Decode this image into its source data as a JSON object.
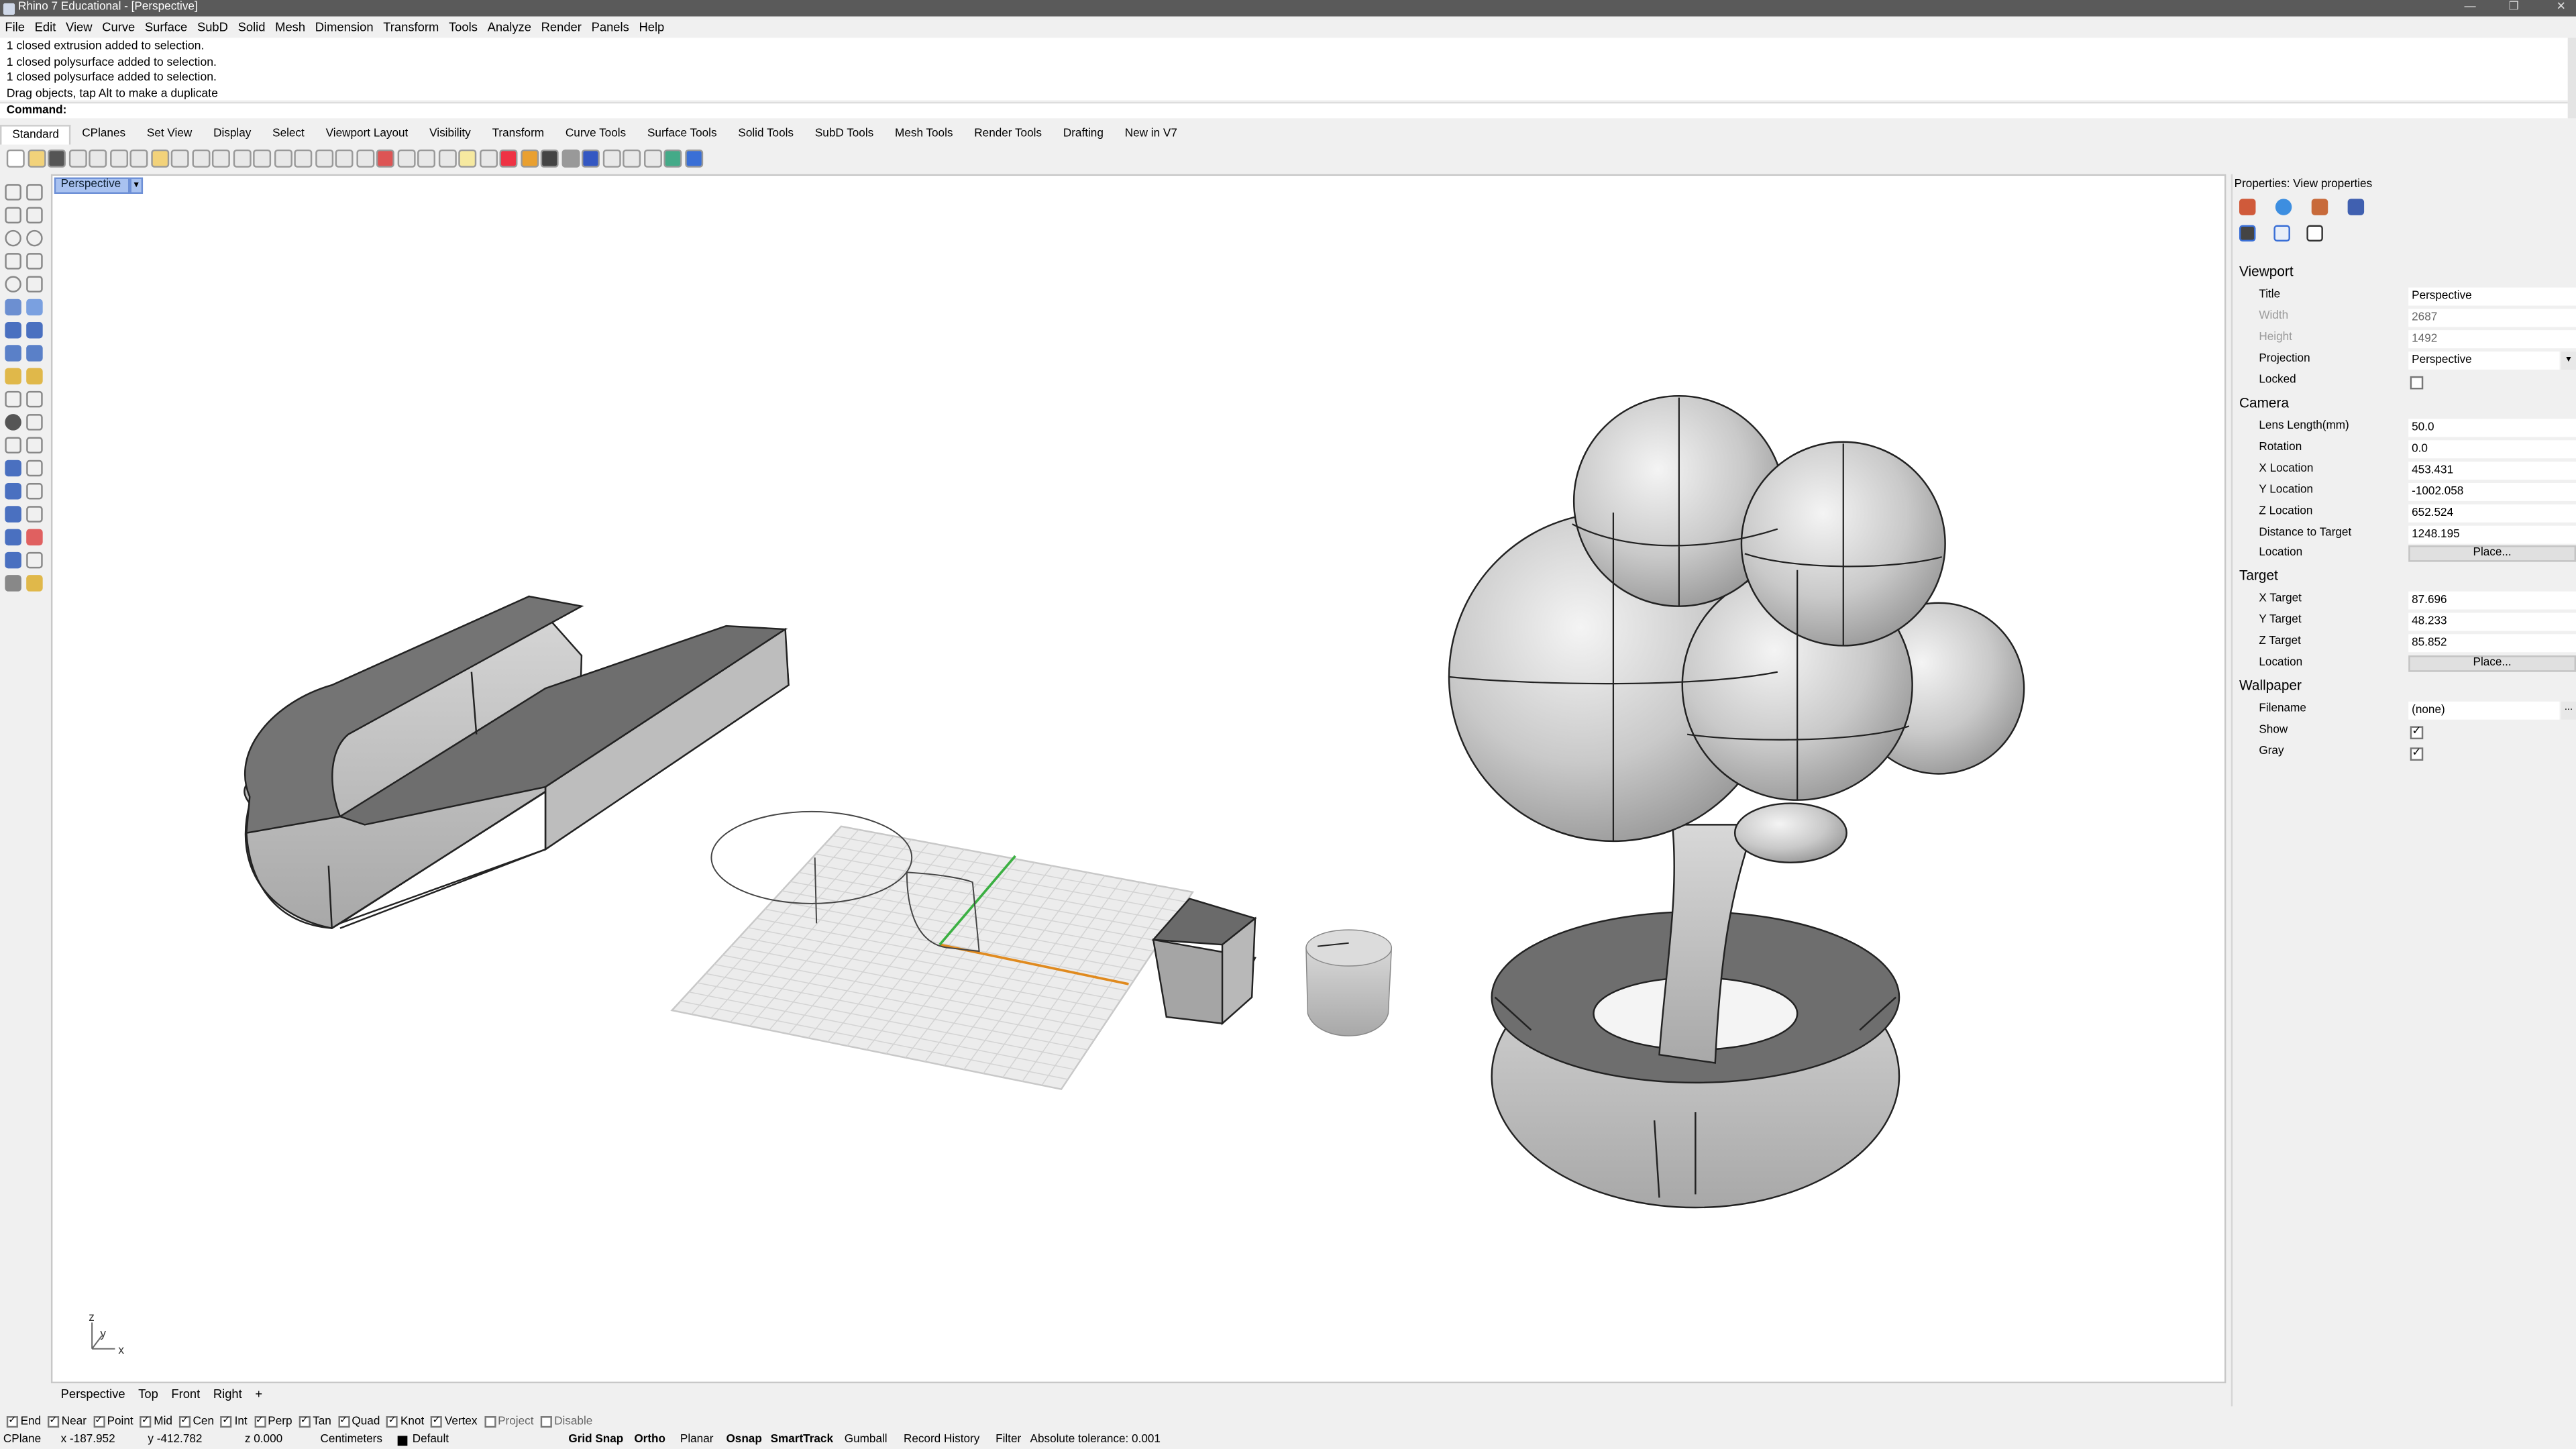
{
  "window": {
    "title": "Rhino 7 Educational - [Perspective]"
  },
  "menu": [
    "File",
    "Edit",
    "View",
    "Curve",
    "Surface",
    "SubD",
    "Solid",
    "Mesh",
    "Dimension",
    "Transform",
    "Tools",
    "Analyze",
    "Render",
    "Panels",
    "Help"
  ],
  "command_history": [
    "1 closed extrusion added to selection.",
    "1 closed polysurface added to selection.",
    "1 closed polysurface added to selection.",
    "Drag objects, tap Alt to make a duplicate"
  ],
  "command_prompt": "Command:",
  "toolbar_tabs": [
    "Standard",
    "CPlanes",
    "Set View",
    "Display",
    "Select",
    "Viewport Layout",
    "Visibility",
    "Transform",
    "Curve Tools",
    "Surface Tools",
    "Solid Tools",
    "SubD Tools",
    "Mesh Tools",
    "Render Tools",
    "Drafting",
    "New in V7"
  ],
  "viewport": {
    "active_label": "Perspective",
    "axis_z": "z",
    "axis_y": "y",
    "axis_x": "x"
  },
  "viewport_tabs": [
    "Perspective",
    "Top",
    "Front",
    "Right"
  ],
  "add_tab": "+",
  "osnaps": [
    {
      "label": "End",
      "checked": true
    },
    {
      "label": "Near",
      "checked": true
    },
    {
      "label": "Point",
      "checked": true
    },
    {
      "label": "Mid",
      "checked": true
    },
    {
      "label": "Cen",
      "checked": true
    },
    {
      "label": "Int",
      "checked": true
    },
    {
      "label": "Perp",
      "checked": true
    },
    {
      "label": "Tan",
      "checked": true
    },
    {
      "label": "Quad",
      "checked": true
    },
    {
      "label": "Knot",
      "checked": true
    },
    {
      "label": "Vertex",
      "checked": true
    },
    {
      "label": "Project",
      "checked": false
    },
    {
      "label": "Disable",
      "checked": false
    }
  ],
  "status": {
    "cplane": "CPlane",
    "x": "x -187.952",
    "y": "y -412.782",
    "z": "z 0.000",
    "units": "Centimeters",
    "layer": "Default",
    "grid_snap": "Grid Snap",
    "ortho": "Ortho",
    "planar": "Planar",
    "osnap": "Osnap",
    "smarttrack": "SmartTrack",
    "gumball": "Gumball",
    "record_history": "Record History",
    "filter": "Filter",
    "tolerance": "Absolute tolerance: 0.001"
  },
  "properties": {
    "title": "Properties: View properties",
    "viewport_heading": "Viewport",
    "viewport_rows": [
      {
        "label": "Title",
        "value": "Perspective",
        "dim": false
      },
      {
        "label": "Width",
        "value": "2687",
        "dim": true
      },
      {
        "label": "Height",
        "value": "1492",
        "dim": true
      },
      {
        "label": "Projection",
        "value": "Perspective",
        "dim": false
      }
    ],
    "locked_label": "Locked",
    "camera_heading": "Camera",
    "camera_rows": [
      {
        "label": "Lens Length(mm)",
        "value": "50.0"
      },
      {
        "label": "Rotation",
        "value": "0.0"
      },
      {
        "label": "X Location",
        "value": "453.431"
      },
      {
        "label": "Y Location",
        "value": "-1002.058"
      },
      {
        "label": "Z Location",
        "value": "652.524"
      },
      {
        "label": "Distance to Target",
        "value": "1248.195"
      }
    ],
    "location_label": "Location",
    "place_button": "Place...",
    "target_heading": "Target",
    "target_rows": [
      {
        "label": "X Target",
        "value": "87.696"
      },
      {
        "label": "Y Target",
        "value": "48.233"
      },
      {
        "label": "Z Target",
        "value": "85.852"
      }
    ],
    "wallpaper_heading": "Wallpaper",
    "filename_label": "Filename",
    "filename_value": "(none)",
    "browse": "...",
    "show_label": "Show",
    "gray_label": "Gray"
  },
  "colors": {
    "accent": "#a9c2f0",
    "brand": "#e0161b",
    "grid_x": "#e08a1e",
    "grid_y": "#3cb043"
  }
}
